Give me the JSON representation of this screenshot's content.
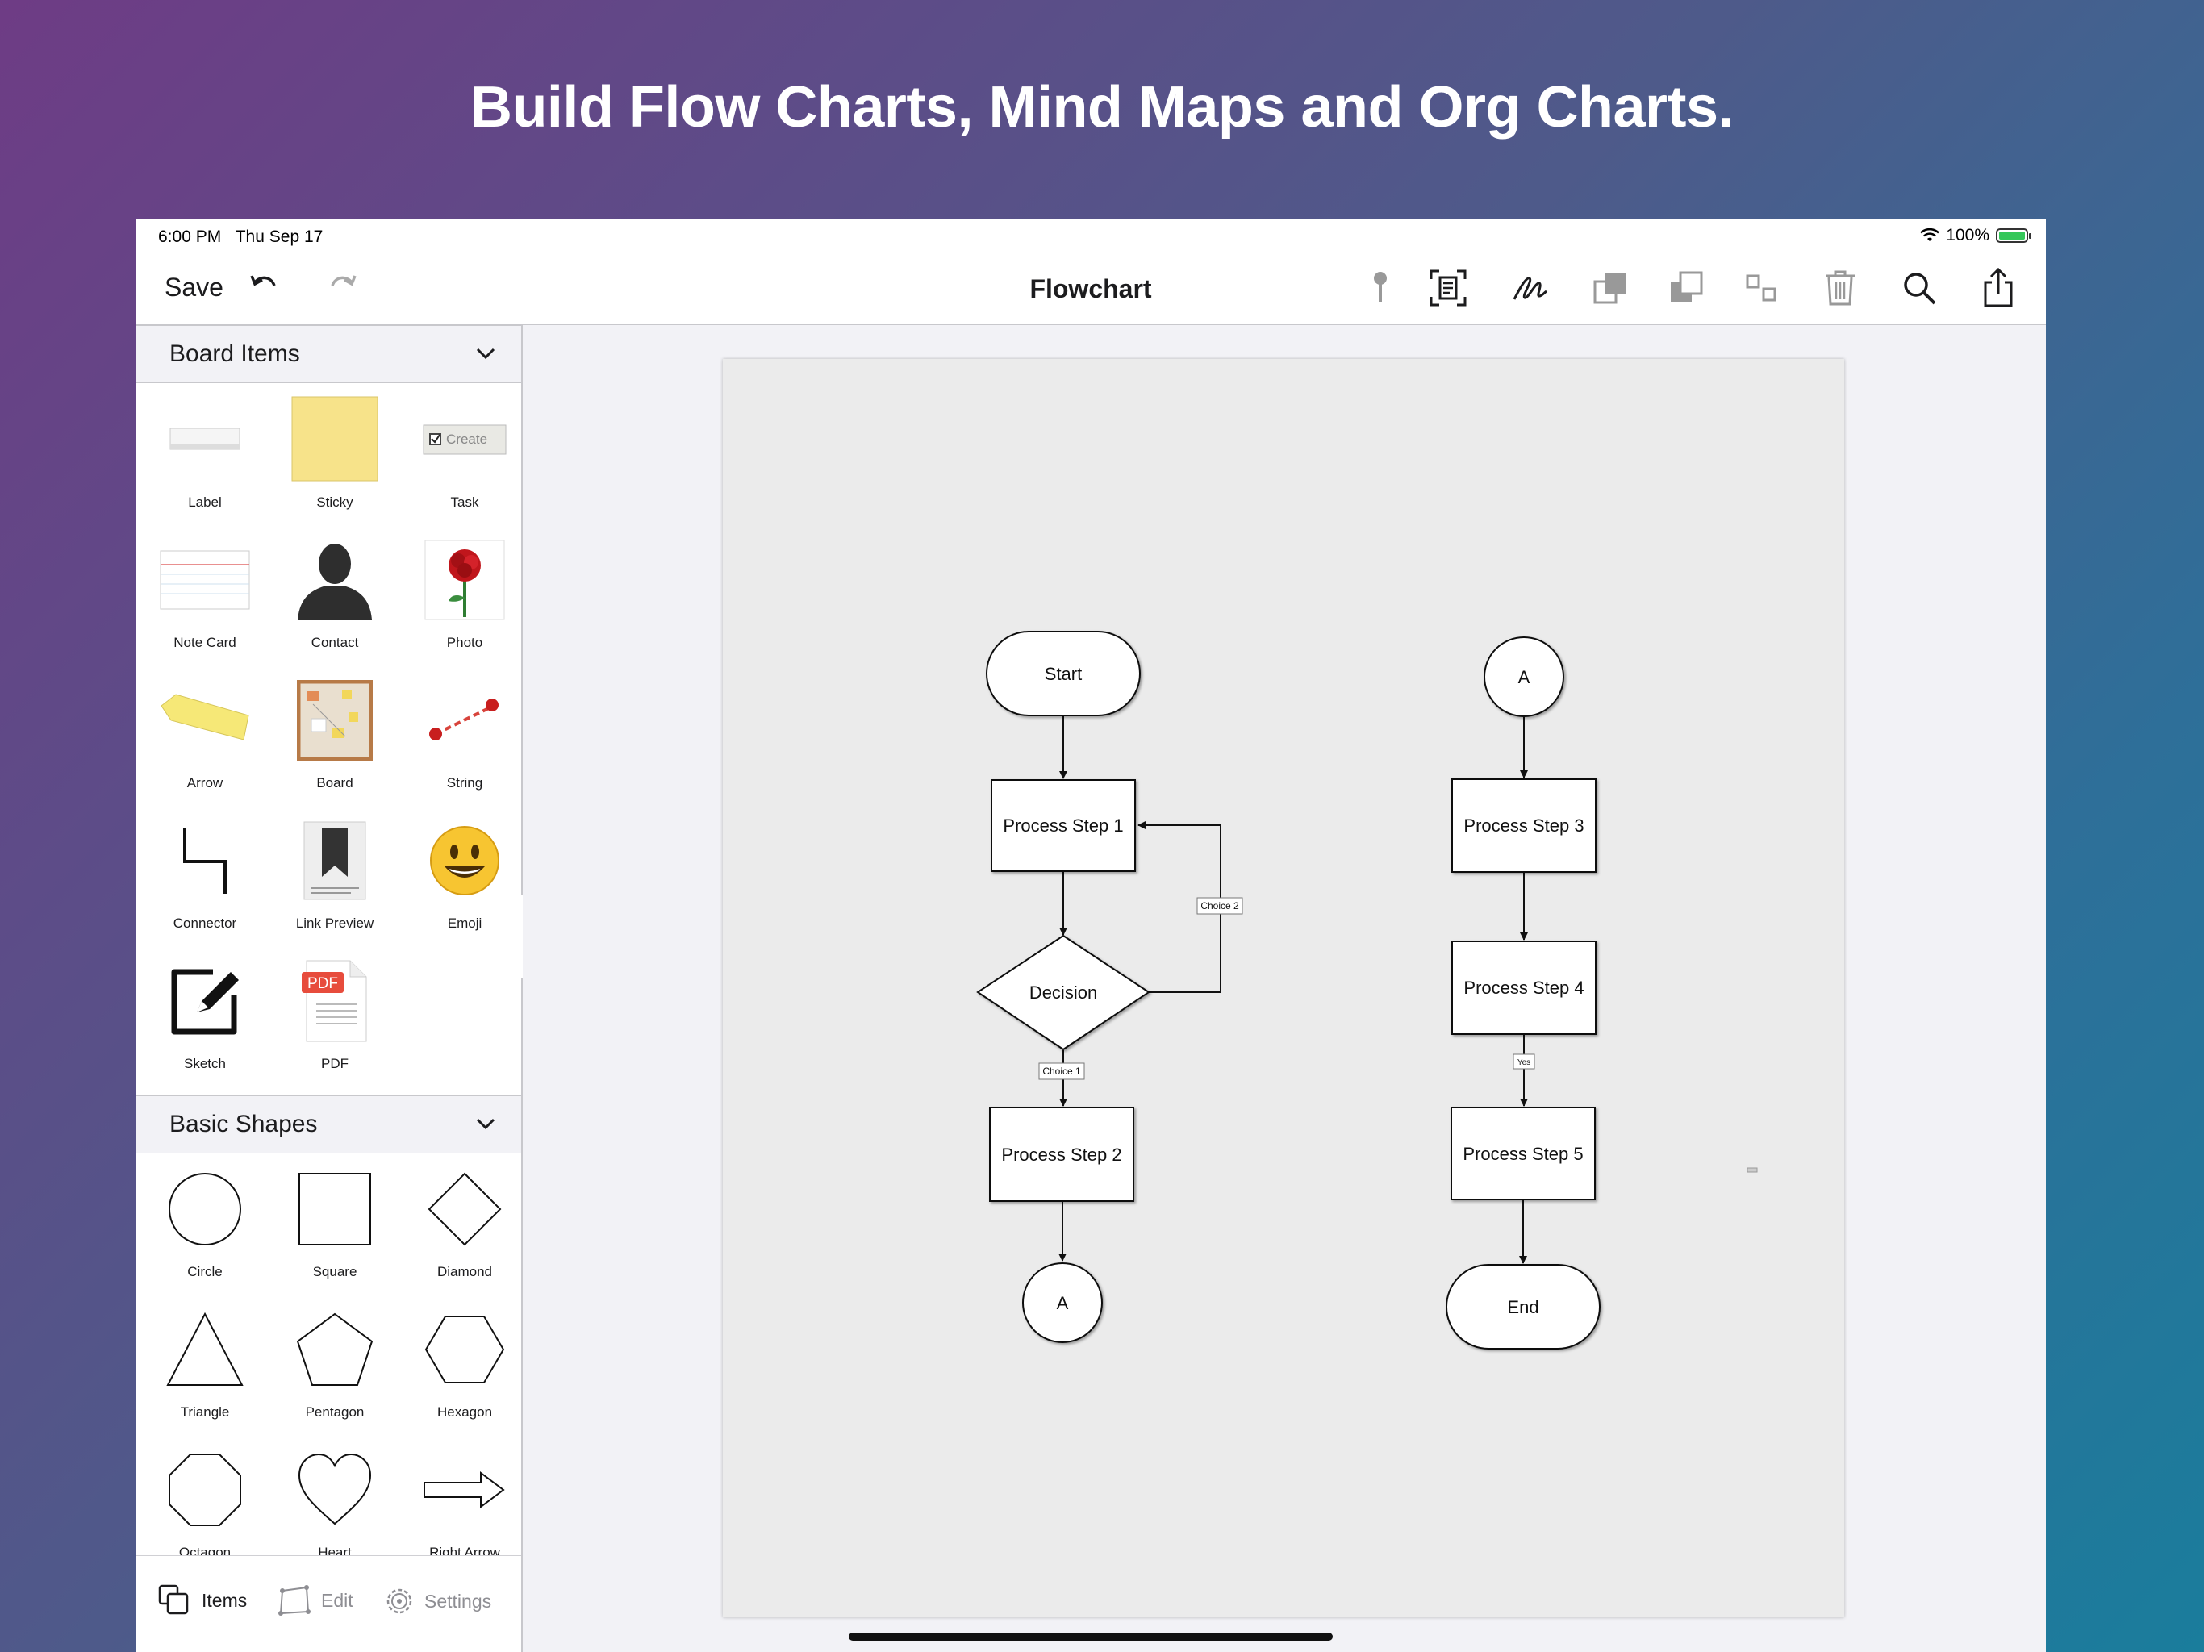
{
  "headline": "Build Flow Charts, Mind Maps and Org Charts.",
  "status": {
    "time": "6:00 PM",
    "date": "Thu Sep 17",
    "battery": "100%"
  },
  "nav": {
    "save": "Save",
    "title": "Flowchart"
  },
  "sidebar": {
    "board_items_title": "Board Items",
    "board_items": [
      "Label",
      "Sticky",
      "Task",
      "Note Card",
      "Contact",
      "Photo",
      "Arrow",
      "Board",
      "String",
      "Connector",
      "Link Preview",
      "Emoji",
      "Sketch",
      "PDF"
    ],
    "task_thumb_text": "Create",
    "pdf_badge": "PDF",
    "basic_shapes_title": "Basic Shapes",
    "basic_shapes": [
      "Circle",
      "Square",
      "Diamond",
      "Triangle",
      "Pentagon",
      "Hexagon",
      "Octagon",
      "Heart",
      "Right Arrow"
    ]
  },
  "tabs": [
    {
      "label": "Items",
      "active": true
    },
    {
      "label": "Edit",
      "active": false
    },
    {
      "label": "Settings",
      "active": false
    }
  ],
  "flowchart": {
    "start": "Start",
    "step1": "Process Step 1",
    "decision": "Decision",
    "choice1": "Choice 1",
    "choice2": "Choice 2",
    "step2": "Process Step 2",
    "connector_a_bottom": "A",
    "connector_a_top": "A",
    "step3": "Process Step 3",
    "step4": "Process Step 4",
    "yes": "Yes",
    "step5": "Process Step 5",
    "end": "End"
  },
  "colors": {
    "accent_green": "#34c759",
    "sticky_yellow": "#f7e38a",
    "pdf_red": "#e74c3c"
  }
}
